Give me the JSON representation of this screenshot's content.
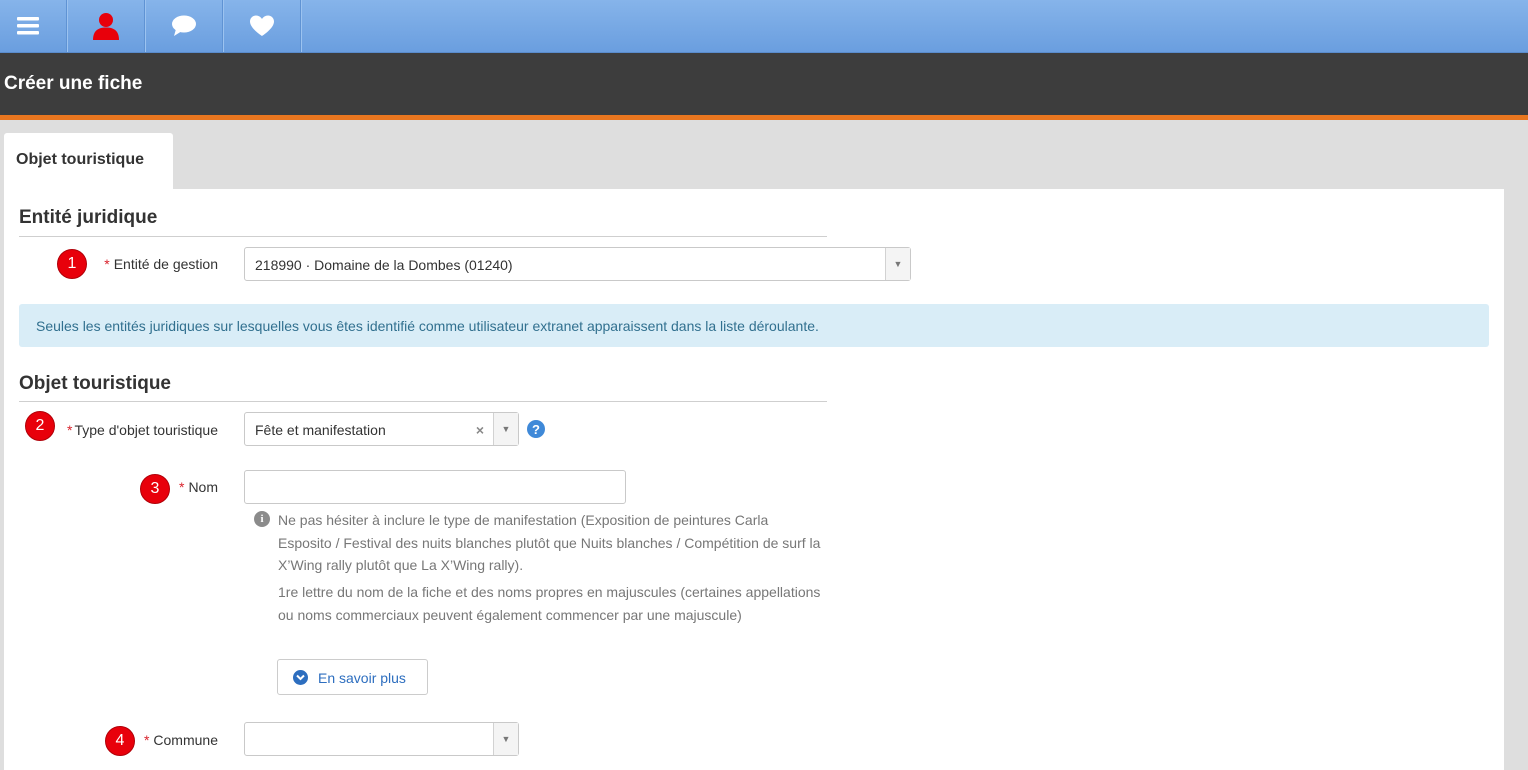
{
  "toolbar": {
    "icons": [
      "menu-icon",
      "user-icon",
      "chat-icon",
      "heart-icon"
    ],
    "user_icon_color": "#e8000b"
  },
  "page_title": "Créer une fiche",
  "tab_label": "Objet touristique",
  "sections": {
    "entite": {
      "title": "Entité juridique"
    },
    "objet": {
      "title": "Objet touristique"
    }
  },
  "fields": {
    "entite_gestion": {
      "badge": "1",
      "required_mark": "*",
      "label": "Entité de gestion",
      "value": "218990 · Domaine de la Dombes (01240)"
    },
    "type_objet": {
      "badge": "2",
      "required_mark": "*",
      "label": "Type d'objet touristique",
      "value": "Fête et manifestation",
      "clear_glyph": "×",
      "help_glyph": "?"
    },
    "nom": {
      "badge": "3",
      "required_mark": "*",
      "label": "Nom",
      "value": ""
    },
    "commune": {
      "badge": "4",
      "required_mark": "*",
      "label": "Commune",
      "value": ""
    }
  },
  "info_alert": "Seules les entités juridiques sur lesquelles vous êtes identifié comme utilisateur extranet apparaissent dans la liste déroulante.",
  "nom_hint": {
    "icon_glyph": "i",
    "para1": "Ne pas hésiter à inclure le type de manifestation (Exposition de peintures Carla Esposito / Festival des nuits blanches plutôt que Nuits blanches / Compétition de surf la X’Wing rally plutôt que La X’Wing rally).",
    "para2": "1re lettre du nom de la fiche et des noms propres en majuscules (certaines appellations ou noms commerciaux peuvent également commencer par une majuscule)",
    "more_button": "En savoir plus"
  },
  "colors": {
    "toolbar_blue": "#7aaae6",
    "title_bar": "#3d3d3d",
    "accent_orange": "#e9761f",
    "badge_red": "#e8000b",
    "alert_bg": "#d9edf7",
    "alert_text": "#31708f",
    "link_blue": "#2d6ebf"
  }
}
